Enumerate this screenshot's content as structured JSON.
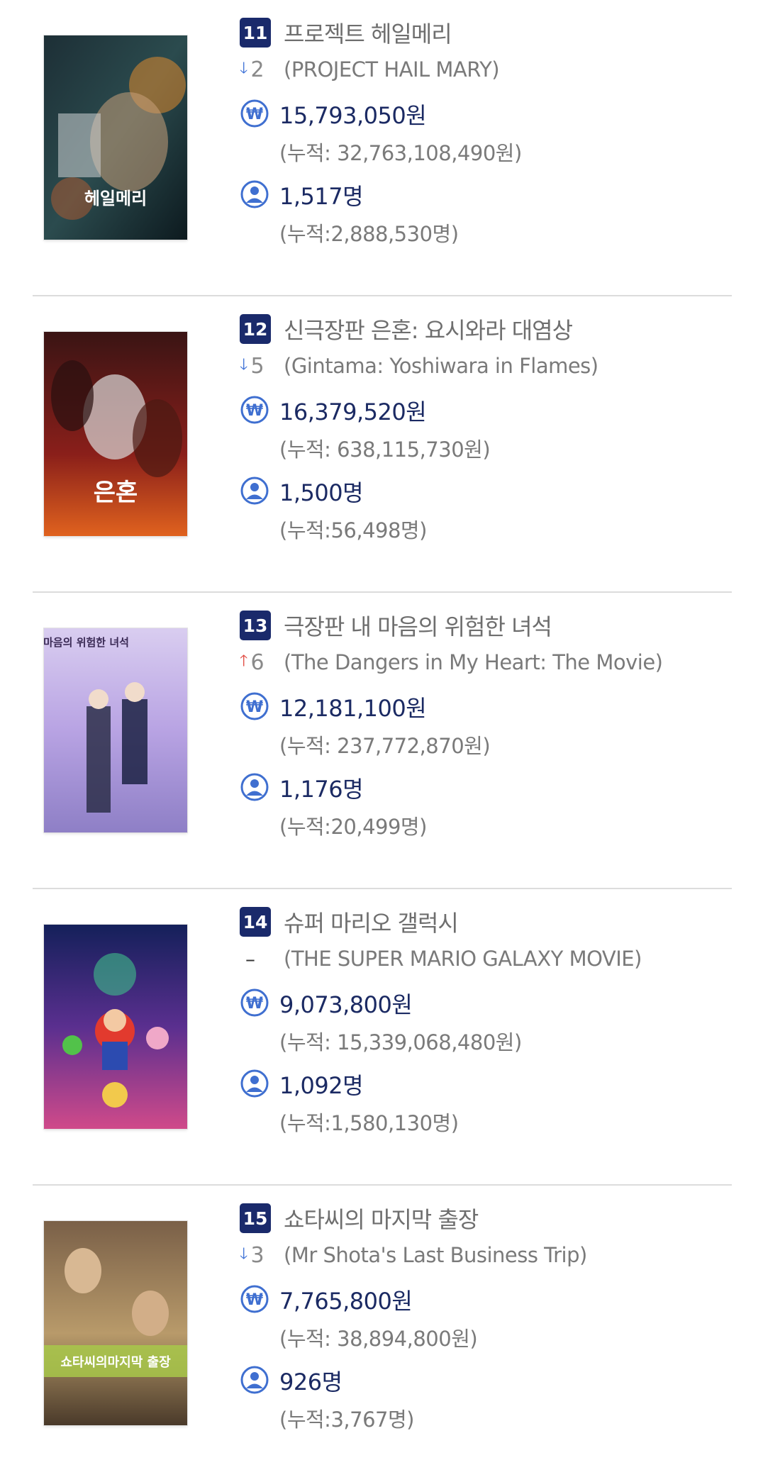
{
  "movies": [
    {
      "rank": "11",
      "title_ko": "프로젝트 헤일메리",
      "change_dir": "down",
      "change_num": "2",
      "title_en": "(PROJECT HAIL MARY)",
      "sales": "15,793,050원",
      "sales_cum": "(누적: 32,763,108,490원)",
      "audience": "1,517명",
      "audience_cum": "(누적:2,888,530명)",
      "poster_text": "헤일메리"
    },
    {
      "rank": "12",
      "title_ko": "신극장판 은혼: 요시와라 대염상",
      "change_dir": "down",
      "change_num": "5",
      "title_en": "(Gintama: Yoshiwara in Flames)",
      "sales": "16,379,520원",
      "sales_cum": "(누적: 638,115,730원)",
      "audience": "1,500명",
      "audience_cum": "(누적:56,498명)",
      "poster_text": "은혼"
    },
    {
      "rank": "13",
      "title_ko": "극장판 내 마음의 위험한 녀석",
      "change_dir": "up",
      "change_num": "6",
      "title_en": "(The Dangers in My Heart: The Movie)",
      "sales": "12,181,100원",
      "sales_cum": "(누적: 237,772,870원)",
      "audience": "1,176명",
      "audience_cum": "(누적:20,499명)",
      "poster_text": "내 마음의 위험한 녀석"
    },
    {
      "rank": "14",
      "title_ko": "슈퍼 마리오 갤럭시",
      "change_dir": "none",
      "change_num": "–",
      "title_en": "(THE SUPER MARIO GALAXY MOVIE)",
      "sales": "9,073,800원",
      "sales_cum": "(누적: 15,339,068,480원)",
      "audience": "1,092명",
      "audience_cum": "(누적:1,580,130명)",
      "poster_text": ""
    },
    {
      "rank": "15",
      "title_ko": "쇼타씨의 마지막 출장",
      "change_dir": "down",
      "change_num": "3",
      "title_en": "(Mr Shota's Last Business Trip)",
      "sales": "7,765,800원",
      "sales_cum": "(누적: 38,894,800원)",
      "audience": "926명",
      "audience_cum": "(누적:3,767명)",
      "poster_text": "쇼타씨의마지막 출장"
    }
  ],
  "icons": {
    "sales": "won-icon",
    "audience": "person-icon",
    "down": "arrow-down-icon",
    "up": "arrow-up-icon"
  },
  "colors": {
    "badge": "#1a2a6b",
    "icon": "#3f6fd0",
    "value": "#1b2a63",
    "down": "#3a6fd6",
    "up": "#e0453c"
  }
}
